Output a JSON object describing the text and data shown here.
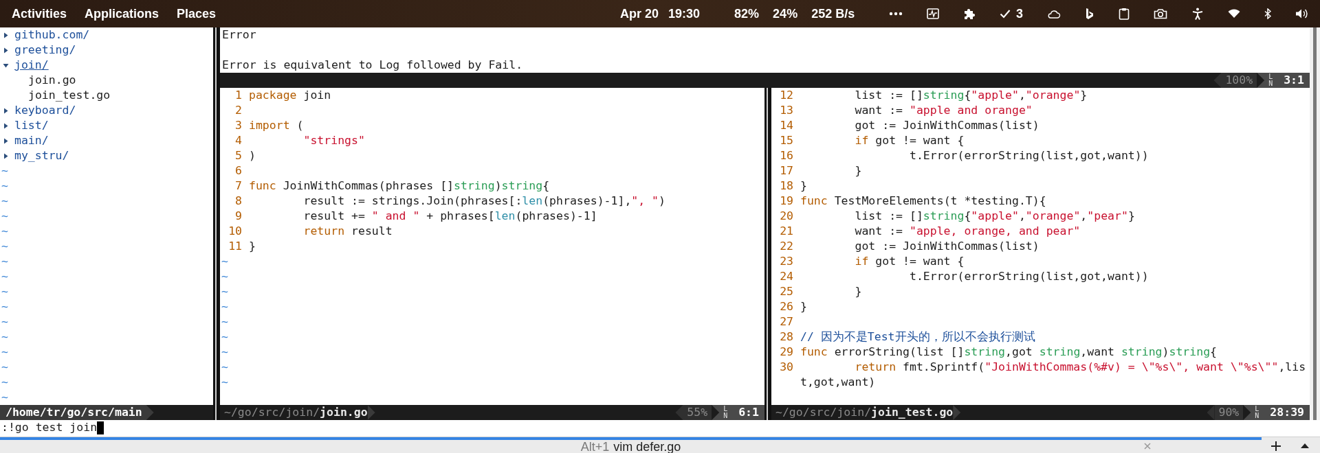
{
  "top_bar": {
    "menus": [
      "Activities",
      "Applications",
      "Places"
    ],
    "date": "Apr 20",
    "time": "19:30",
    "cpu": "82%",
    "memory": "24%",
    "network": "252 B/s",
    "tasks_count": "3"
  },
  "file_tree": {
    "items": [
      {
        "name": "github.com/",
        "kind": "dir",
        "expanded": false,
        "cursor": false
      },
      {
        "name": "greeting/",
        "kind": "dir",
        "expanded": false,
        "cursor": false
      },
      {
        "name": "join/",
        "kind": "dir",
        "expanded": true,
        "cursor": true,
        "children": [
          {
            "name": "join.go",
            "kind": "file"
          },
          {
            "name": "join_test.go",
            "kind": "file"
          }
        ]
      },
      {
        "name": "keyboard/",
        "kind": "dir",
        "expanded": false,
        "cursor": false
      },
      {
        "name": "list/",
        "kind": "dir",
        "expanded": false,
        "cursor": false
      },
      {
        "name": "main/",
        "kind": "dir",
        "expanded": false,
        "cursor": false
      },
      {
        "name": "my_stru/",
        "kind": "dir",
        "expanded": false,
        "cursor": false
      }
    ],
    "filler": [
      "~",
      "~",
      "~",
      "~",
      "~",
      "~",
      "~",
      "~",
      "~",
      "~",
      "~",
      "~",
      "~",
      "~",
      "~",
      "~"
    ],
    "status": {
      "path": "/home/tr/go/src/main"
    }
  },
  "help_window": {
    "lines": [
      {
        "kind": "text",
        "text": "Error"
      },
      {
        "kind": "blank"
      },
      {
        "kind": "text",
        "text": "Error is equivalent to Log followed by Fail."
      }
    ],
    "status": {
      "percent": "100%",
      "ln": "LN",
      "position": "3:1"
    }
  },
  "panes": [
    {
      "lines": [
        {
          "number": "1",
          "segments": [
            {
              "kind": "keyword",
              "text": "package"
            },
            {
              "kind": "plain",
              "text": " join"
            }
          ]
        },
        {
          "number": "2"
        },
        {
          "number": "3",
          "segments": [
            {
              "kind": "keyword",
              "text": "import"
            },
            {
              "kind": "plain",
              "text": " ("
            }
          ]
        },
        {
          "number": "4",
          "segments": [
            {
              "kind": "string",
              "text": "        \"strings\""
            }
          ]
        },
        {
          "number": "5",
          "segments": [
            {
              "kind": "plain",
              "text": ")"
            }
          ]
        },
        {
          "number": "6"
        },
        {
          "number": "7",
          "segments": [
            {
              "kind": "keyword",
              "text": "func"
            },
            {
              "kind": "plain",
              "text": " JoinWithCommas(phrases []"
            },
            {
              "kind": "type",
              "text": "string"
            },
            {
              "kind": "plain",
              "text": ")"
            },
            {
              "kind": "type",
              "text": "string"
            },
            {
              "kind": "plain",
              "text": "{"
            }
          ]
        },
        {
          "number": "8",
          "segments": [
            {
              "kind": "plain",
              "text": "        result := strings.Join(phrases[:"
            },
            {
              "kind": "builtin",
              "text": "len"
            },
            {
              "kind": "plain",
              "text": "(phrases)-1],"
            },
            {
              "kind": "string",
              "text": "\", \""
            },
            {
              "kind": "plain",
              "text": ")"
            }
          ]
        },
        {
          "number": "9",
          "segments": [
            {
              "kind": "plain",
              "text": "        result += "
            },
            {
              "kind": "string",
              "text": "\" and \""
            },
            {
              "kind": "plain",
              "text": " + phrases["
            },
            {
              "kind": "builtin",
              "text": "len"
            },
            {
              "kind": "plain",
              "text": "(phrases)-1]"
            }
          ]
        },
        {
          "number": "10",
          "segments": [
            {
              "kind": "keyword",
              "text": "        return"
            },
            {
              "kind": "plain",
              "text": " result"
            }
          ]
        },
        {
          "number": "11",
          "segments": [
            {
              "kind": "plain",
              "text": "}"
            }
          ]
        }
      ],
      "filler": [
        "~",
        "~",
        "~",
        "~",
        "~",
        "~",
        "~",
        "~",
        "~"
      ],
      "status": {
        "dir": "~/go/src/join/",
        "file": "join.go",
        "percent": "55%",
        "ln": "LN",
        "position": "6:1"
      }
    },
    {
      "lines": [
        {
          "number": "12",
          "segments": [
            {
              "kind": "plain",
              "text": "        list := []"
            },
            {
              "kind": "type",
              "text": "string"
            },
            {
              "kind": "plain",
              "text": "{"
            },
            {
              "kind": "string",
              "text": "\"apple\""
            },
            {
              "kind": "plain",
              "text": ","
            },
            {
              "kind": "string",
              "text": "\"orange\""
            },
            {
              "kind": "plain",
              "text": "}"
            }
          ]
        },
        {
          "number": "13",
          "segments": [
            {
              "kind": "plain",
              "text": "        want := "
            },
            {
              "kind": "string",
              "text": "\"apple and orange\""
            }
          ]
        },
        {
          "number": "14",
          "segments": [
            {
              "kind": "plain",
              "text": "        got := JoinWithCommas(list)"
            }
          ]
        },
        {
          "number": "15",
          "segments": [
            {
              "kind": "keyword",
              "text": "        if"
            },
            {
              "kind": "plain",
              "text": " got != want {"
            }
          ]
        },
        {
          "number": "16",
          "segments": [
            {
              "kind": "plain",
              "text": "                t.Error(errorString(list,got,want))"
            }
          ]
        },
        {
          "number": "17",
          "segments": [
            {
              "kind": "plain",
              "text": "        }"
            }
          ]
        },
        {
          "number": "18",
          "segments": [
            {
              "kind": "plain",
              "text": "}"
            }
          ]
        },
        {
          "number": "19",
          "segments": [
            {
              "kind": "keyword",
              "text": "func"
            },
            {
              "kind": "plain",
              "text": " TestMoreElements(t *testing.T){"
            }
          ]
        },
        {
          "number": "20",
          "segments": [
            {
              "kind": "plain",
              "text": "        list := []"
            },
            {
              "kind": "type",
              "text": "string"
            },
            {
              "kind": "plain",
              "text": "{"
            },
            {
              "kind": "string",
              "text": "\"apple\""
            },
            {
              "kind": "plain",
              "text": ","
            },
            {
              "kind": "string",
              "text": "\"orange\""
            },
            {
              "kind": "plain",
              "text": ","
            },
            {
              "kind": "string",
              "text": "\"pear\""
            },
            {
              "kind": "plain",
              "text": "}"
            }
          ]
        },
        {
          "number": "21",
          "segments": [
            {
              "kind": "plain",
              "text": "        want := "
            },
            {
              "kind": "string",
              "text": "\"apple, orange, and pear\""
            }
          ]
        },
        {
          "number": "22",
          "segments": [
            {
              "kind": "plain",
              "text": "        got := JoinWithCommas(list)"
            }
          ]
        },
        {
          "number": "23",
          "segments": [
            {
              "kind": "keyword",
              "text": "        if"
            },
            {
              "kind": "plain",
              "text": " got != want {"
            }
          ]
        },
        {
          "number": "24",
          "segments": [
            {
              "kind": "plain",
              "text": "                t.Error(errorString(list,got,want))"
            }
          ]
        },
        {
          "number": "25",
          "segments": [
            {
              "kind": "plain",
              "text": "        }"
            }
          ]
        },
        {
          "number": "26",
          "segments": [
            {
              "kind": "plain",
              "text": "}"
            }
          ]
        },
        {
          "number": "27"
        },
        {
          "number": "28",
          "segments": [
            {
              "kind": "comment",
              "text": "// 因为不是Test开头的，所以不会执行测试"
            }
          ]
        },
        {
          "number": "29",
          "segments": [
            {
              "kind": "keyword",
              "text": "func"
            },
            {
              "kind": "plain",
              "text": " errorString(list []"
            },
            {
              "kind": "type",
              "text": "string"
            },
            {
              "kind": "plain",
              "text": ",got "
            },
            {
              "kind": "type",
              "text": "string"
            },
            {
              "kind": "plain",
              "text": ",want "
            },
            {
              "kind": "type",
              "text": "string"
            },
            {
              "kind": "plain",
              "text": ")"
            },
            {
              "kind": "type",
              "text": "string"
            },
            {
              "kind": "plain",
              "text": "{"
            }
          ]
        },
        {
          "number": "30",
          "segments": [
            {
              "kind": "keyword",
              "text": "        return"
            },
            {
              "kind": "plain",
              "text": " fmt.Sprintf("
            },
            {
              "kind": "string",
              "text": "\"JoinWithCommas(%#v) = \\\"%s\\\", want \\\"%s\\\"\""
            },
            {
              "kind": "plain",
              "text": ",lis"
            }
          ]
        },
        {
          "segments": [
            {
              "kind": "plain",
              "text": "t,got,want)"
            }
          ]
        }
      ],
      "status": {
        "dir": "~/go/src/join/",
        "file": "join_test.go",
        "percent": "90%",
        "ln": "LN",
        "position": "28:39"
      }
    }
  ],
  "command_line": {
    "text": ":!go test join"
  },
  "tab_bar": {
    "tabs": [
      {
        "shortcut": "Alt+1",
        "title": "vim defer.go",
        "selected": true
      }
    ]
  }
}
